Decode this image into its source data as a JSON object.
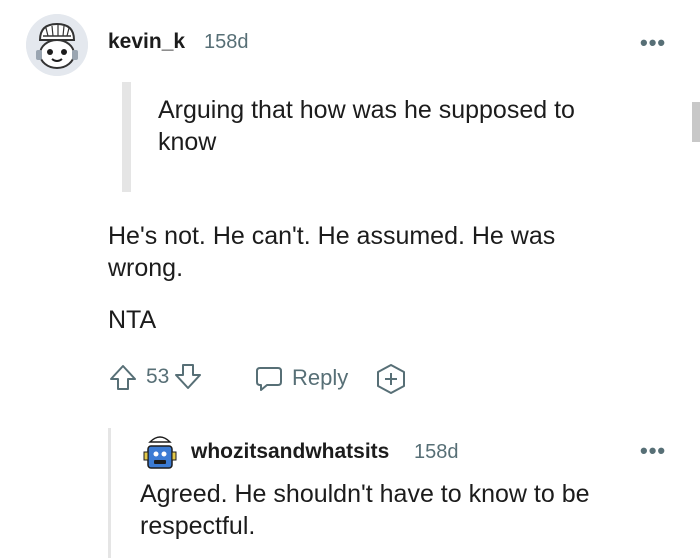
{
  "comment": {
    "username": "kevin_k",
    "age": "158d",
    "more_label": "•••",
    "quote": "Arguing that how was he supposed to know",
    "body": "He's not. He can't. He assumed. He was wrong.",
    "verdict": "NTA",
    "score": "53",
    "reply_label": "Reply",
    "icons": [
      "avatar",
      "upvote-icon",
      "downvote-icon",
      "reply-icon",
      "award-icon",
      "more-icon"
    ]
  },
  "reply": {
    "username": "whozitsandwhatsits",
    "age": "158d",
    "more_label": "•••",
    "body": "Agreed. He shouldn't have to know to be respectful."
  },
  "colors": {
    "text": "#1c1c1c",
    "meta": "#576f76",
    "quote_bar": "#e5e5e5"
  }
}
